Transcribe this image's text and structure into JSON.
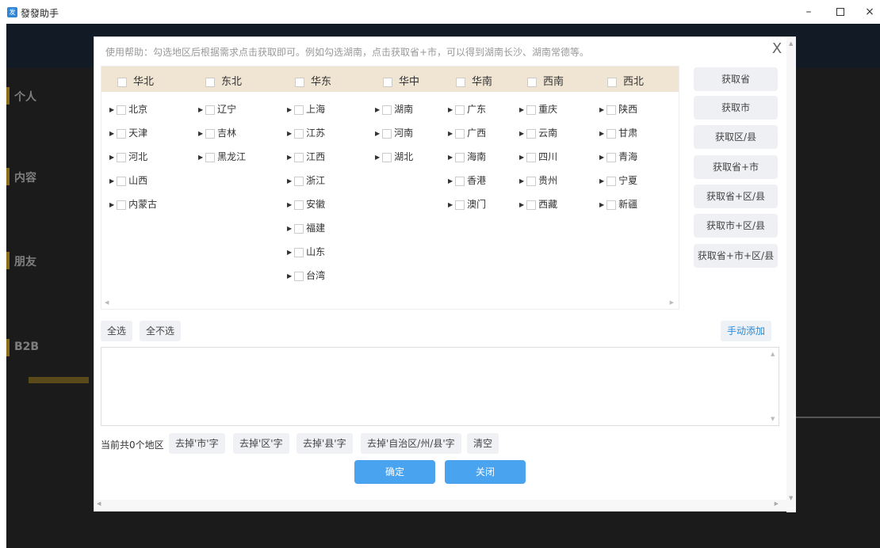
{
  "window": {
    "title": "發發助手",
    "icon_glyph": "发",
    "minimize_glyph": "–",
    "close_glyph": "×"
  },
  "dialog": {
    "help_text": "使用帮助：勾选地区后根据需求点击获取即可。例如勾选湖南，点击获取省+市，可以得到湖南长沙、湖南常德等。",
    "close_glyph": "X",
    "regions": [
      {
        "label": "华北",
        "provinces": [
          "北京",
          "天津",
          "河北",
          "山西",
          "内蒙古"
        ]
      },
      {
        "label": "东北",
        "provinces": [
          "辽宁",
          "吉林",
          "黑龙江"
        ]
      },
      {
        "label": "华东",
        "provinces": [
          "上海",
          "江苏",
          "江西",
          "浙江",
          "安徽",
          "福建",
          "山东",
          "台湾"
        ]
      },
      {
        "label": "华中",
        "provinces": [
          "湖南",
          "河南",
          "湖北"
        ]
      },
      {
        "label": "华南",
        "provinces": [
          "广东",
          "广西",
          "海南",
          "香港",
          "澳门"
        ]
      },
      {
        "label": "西南",
        "provinces": [
          "重庆",
          "云南",
          "四川",
          "贵州",
          "西藏"
        ]
      },
      {
        "label": "西北",
        "provinces": [
          "陕西",
          "甘肃",
          "青海",
          "宁夏",
          "新疆"
        ]
      }
    ],
    "actions": [
      "获取省",
      "获取市",
      "获取区/县",
      "获取省+市",
      "获取省+区/县",
      "获取市+区/县",
      "获取省+市+区/县"
    ],
    "select_all": "全选",
    "select_none": "全不选",
    "manual_add": "手动添加",
    "output_value": "",
    "count_text": "当前共0个地区",
    "tools": [
      "去掉'市'字",
      "去掉'区'字",
      "去掉'县'字",
      "去掉'自治区/州/县'字",
      "清空"
    ],
    "confirm": "确定",
    "close": "关闭"
  },
  "background": {
    "side_labels": [
      "个人",
      "内容",
      "朋友",
      "B2B"
    ]
  }
}
